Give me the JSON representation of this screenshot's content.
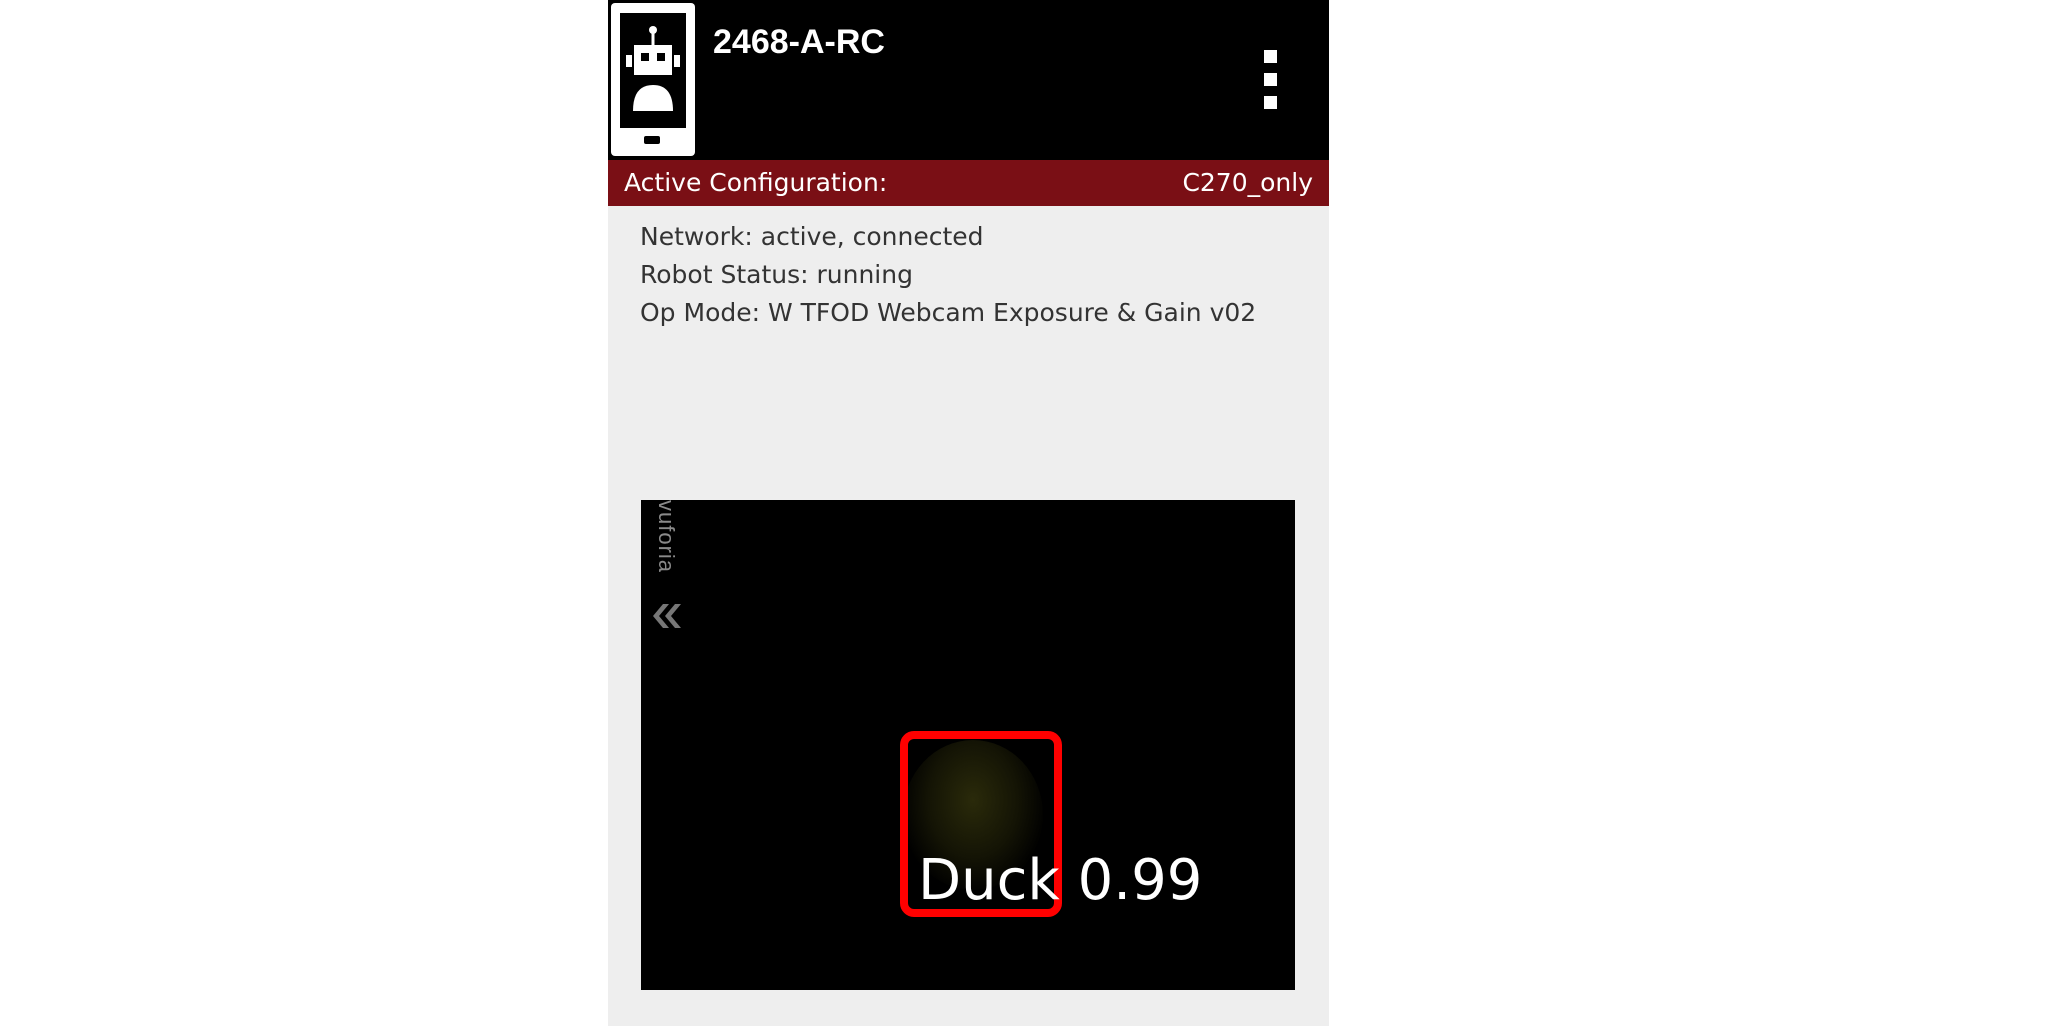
{
  "app_bar": {
    "title": "2468-A-RC",
    "icon": "robot-phone-icon",
    "menu_icon": "more-vert-icon"
  },
  "config_bar": {
    "label": "Active Configuration:",
    "value": "C270_only",
    "color": "#7a0f15"
  },
  "status": {
    "network": "Network: active, connected",
    "robot_status": "Robot Status: running",
    "op_mode": "Op Mode: W TFOD Webcam Exposure & Gain v02"
  },
  "camera": {
    "watermark": "vuforia",
    "detection": {
      "label": "Duck 0.99",
      "box_color": "#ff0000"
    }
  }
}
